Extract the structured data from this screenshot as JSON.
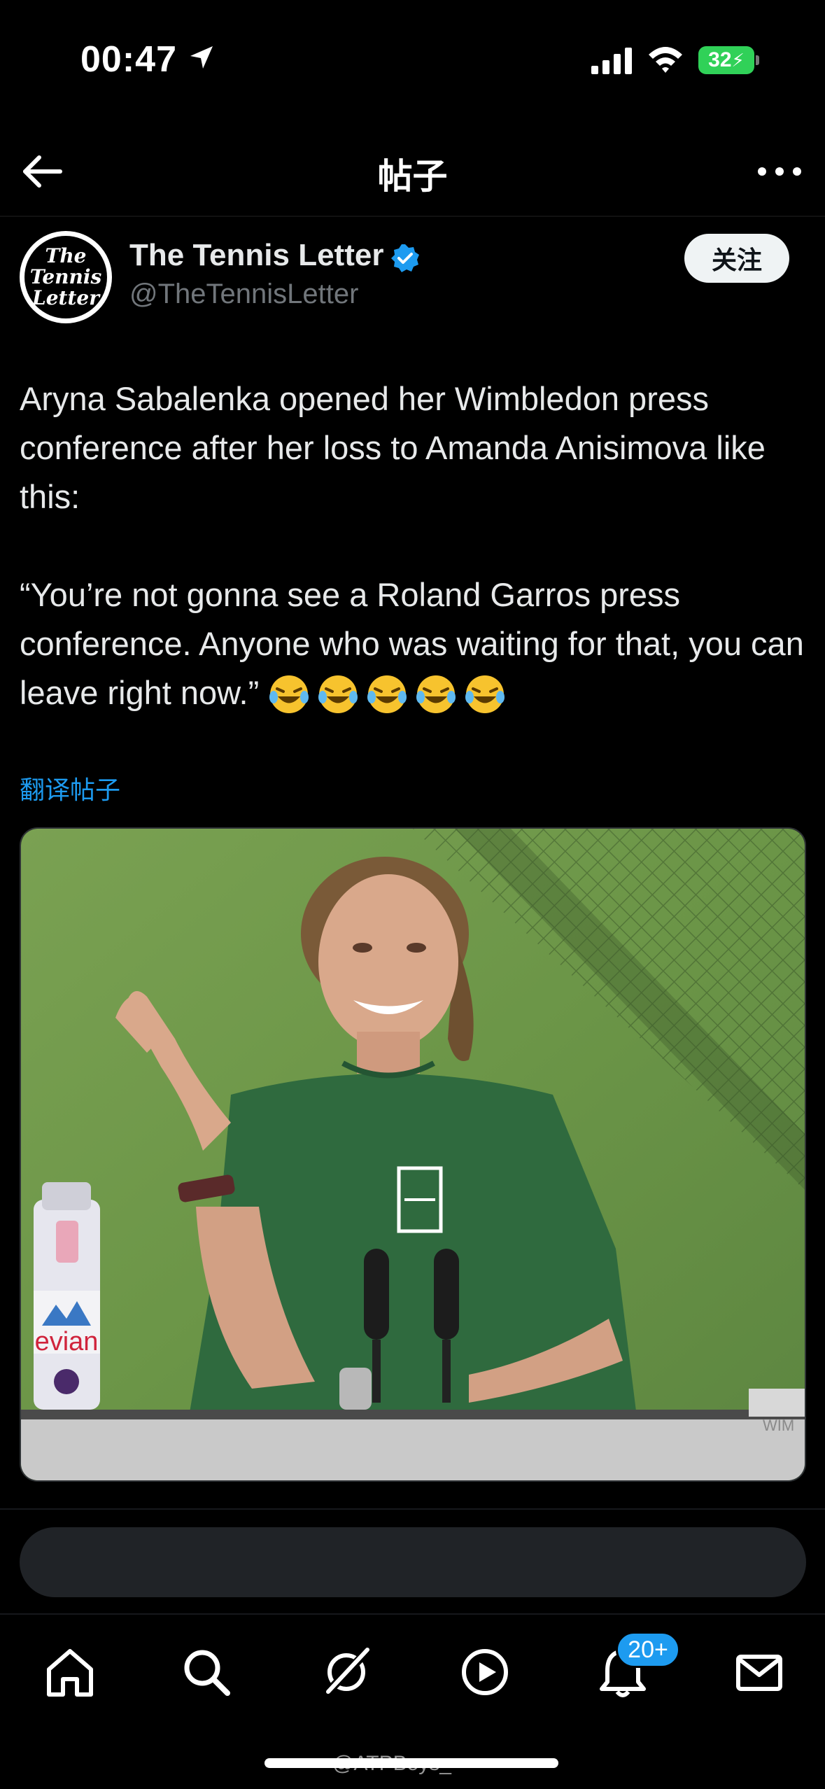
{
  "status_bar": {
    "time": "00:47",
    "battery": "32"
  },
  "nav": {
    "title": "帖子"
  },
  "post": {
    "author_name": "The Tennis Letter",
    "author_handle": "@TheTennisLetter",
    "avatar_text": [
      "The",
      "Tennis",
      "Letter"
    ],
    "follow_label": "关注",
    "text_line1": "Aryna Sabalenka opened her Wimbledon press conference after her loss to Amanda Anisimova like this:",
    "text_line2": "“You’re not gonna see a Roland Garros press conference. Anyone who was waiting for that, you can leave right now.”",
    "translate_label": "翻译帖子",
    "media_caption_text": "evian",
    "media_corner_text": "WIM"
  },
  "tabbar": {
    "notifications_badge": "20+"
  },
  "watermark": "@ATPBoys_",
  "colors": {
    "accent": "#1d9bf0",
    "follow_bg": "#eff3f4",
    "battery": "#30d158"
  }
}
